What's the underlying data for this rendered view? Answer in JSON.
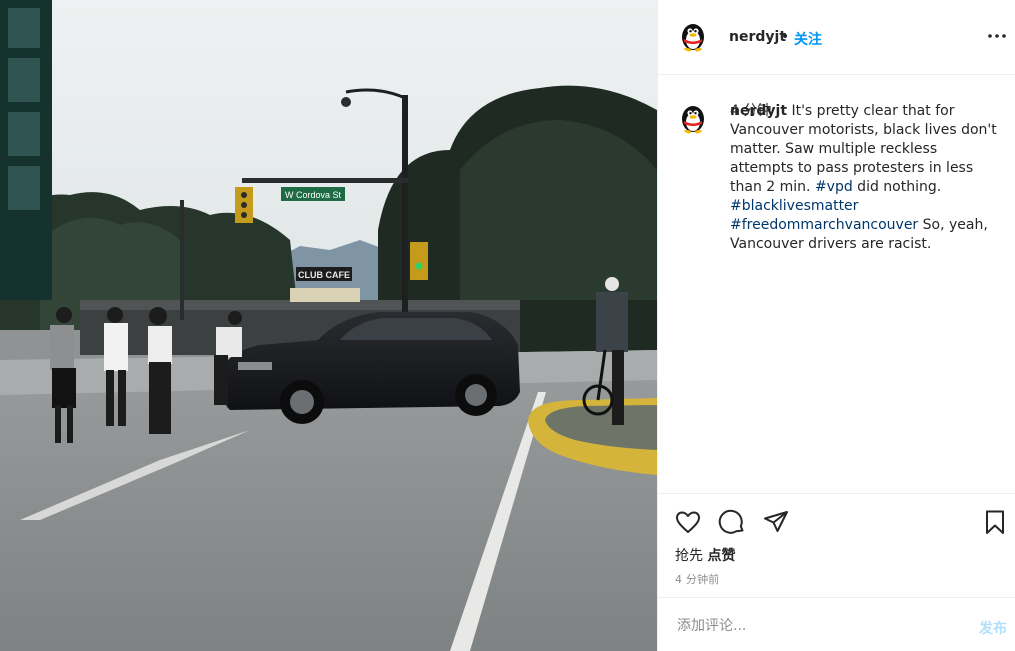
{
  "post": {
    "author": {
      "username": "nerdyjt",
      "avatar_icon": "qq-penguin-avatar"
    },
    "header": {
      "separator": "•",
      "follow_label": "关注",
      "more_icon": "more-horizontal-icon"
    },
    "image": {
      "street_sign": "W Cordova St",
      "storefront_sign": "CLUB CAFE"
    },
    "caption": {
      "username": "nerdyjt",
      "text_1": " It's pretty clear that for Vancouver motorists, black lives don't matter. Saw multiple reckless attempts to pass protesters in less than 2 min. ",
      "tag_1": "#vpd",
      "text_2": " did nothing. ",
      "tag_2": "#blacklivesmatter",
      "text_3": " ",
      "tag_3": "#freedommarchvancouver",
      "text_4": " So, yeah, Vancouver drivers are racist.",
      "time": "4 分钟"
    },
    "actions": {
      "like_icon": "heart-icon",
      "comment_icon": "comment-icon",
      "share_icon": "share-icon",
      "save_icon": "bookmark-icon"
    },
    "likes": {
      "prefix": "抢先 ",
      "label": "点赞"
    },
    "posted_time": "4 分钟前",
    "comment_input": {
      "placeholder": "添加评论...",
      "submit_label": "发布"
    },
    "colors": {
      "link_blue": "#0095f6",
      "hashtag": "#00376b",
      "muted": "#8e8e8e",
      "publish_disabled": "#b2dffc",
      "border": "#efefef"
    }
  }
}
